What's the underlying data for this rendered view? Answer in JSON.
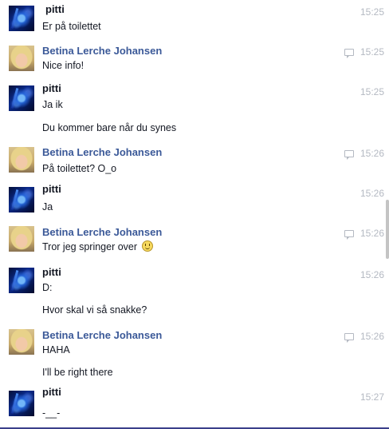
{
  "colors": {
    "sender_blue": "#3b5998",
    "timestamp_gray": "#b4b9c2",
    "text": "#141823"
  },
  "messages": [
    {
      "sender": "pitti",
      "time": "15:25",
      "seen": false,
      "lines": [
        "Er på toilettet"
      ]
    },
    {
      "sender": "Betina Lerche Johansen",
      "time": "15:25",
      "seen": true,
      "lines": [
        "Nice info!"
      ]
    },
    {
      "sender": "pitti",
      "time": "15:25",
      "seen": false,
      "lines": [
        "Ja ik",
        "Du kommer bare når du synes"
      ]
    },
    {
      "sender": "Betina Lerche Johansen",
      "time": "15:26",
      "seen": true,
      "lines": [
        "På toilettet? O_o"
      ]
    },
    {
      "sender": "pitti",
      "time": "15:26",
      "seen": false,
      "lines": [
        "Ja"
      ]
    },
    {
      "sender": "Betina Lerche Johansen",
      "time": "15:26",
      "seen": true,
      "lines": [
        "Tror jeg springer over"
      ],
      "emoji": "smiley-icon"
    },
    {
      "sender": "pitti",
      "time": "15:26",
      "seen": false,
      "lines": [
        "D:",
        "Hvor skal vi så snakke?"
      ]
    },
    {
      "sender": "Betina Lerche Johansen",
      "time": "15:26",
      "seen": true,
      "lines": [
        "HAHA",
        "I'll be right there"
      ]
    },
    {
      "sender": "pitti",
      "time": "15:27",
      "seen": false,
      "lines": [
        "-__-"
      ]
    }
  ]
}
